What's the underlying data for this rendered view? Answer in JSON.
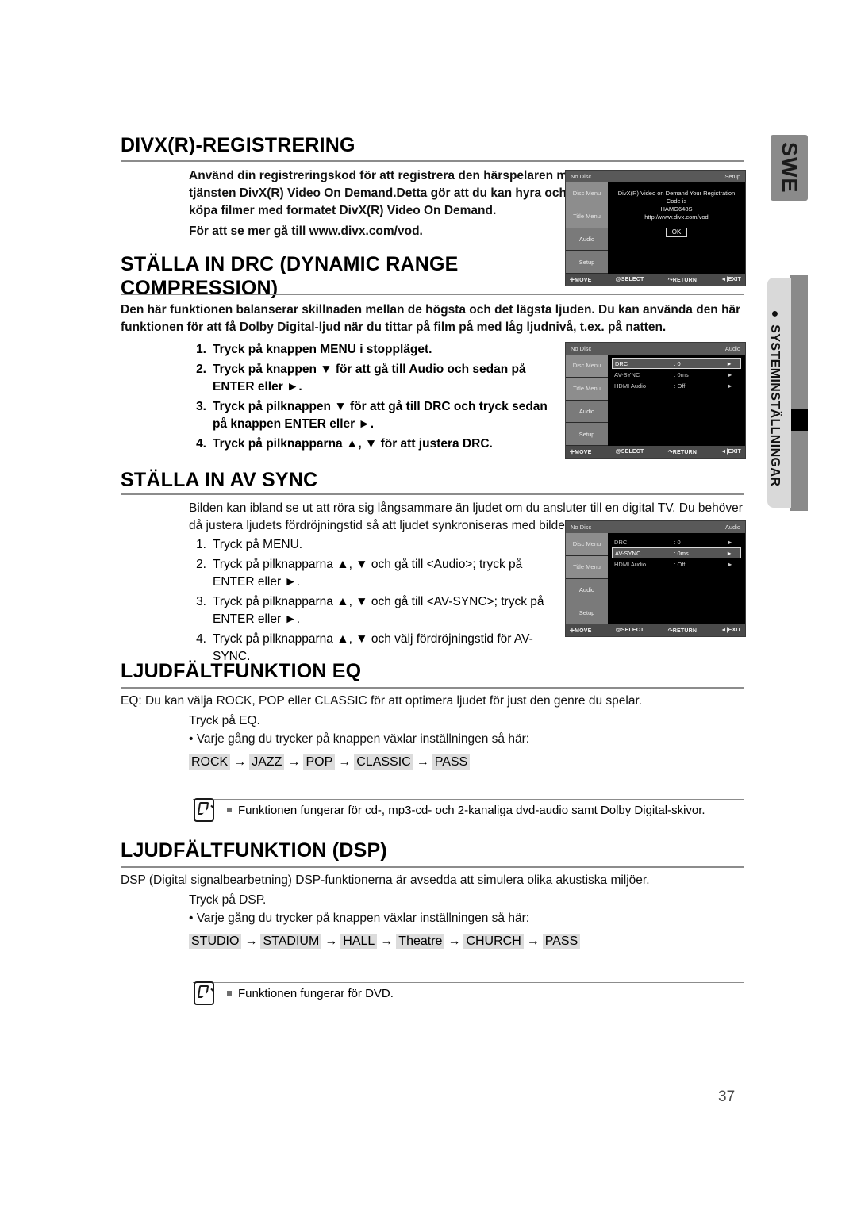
{
  "page": {
    "number": "37",
    "language_tab": "SWE",
    "side_label": "SYSTEMINSTÄLLNINGAR",
    "side_bullet": "●"
  },
  "sections": {
    "divx": {
      "heading": "DIVX(R)-REGISTRERING",
      "body": "Använd din registreringskod för att registrera den härspelaren med tjänsten DivX(R) Video On Demand.Detta gör att du kan hyra och köpa filmer med formatet DivX(R) Video On Demand.",
      "body_line1": "Använd din registreringskod för att registrera den härspelaren med",
      "body_line2": "tjänsten DivX(R) Video On Demand.Detta gör att du kan hyra och",
      "body_line3": "köpa filmer med formatet DivX(R) Video On Demand.",
      "body_line4": "För att se mer gå till www.divx.com/vod."
    },
    "drc": {
      "heading_line1": "STÄLLA IN DRC (DYNAMIC RANGE",
      "heading_line2": "COMPRESSION)",
      "intro_line1": "Den här funktionen balanserar skillnaden mellan de högsta och det lägsta ljuden. Du kan använda den här",
      "intro_line2": "funktionen för att få Dolby Digital-ljud när du tittar på film på med låg ljudnivå, t.ex. på natten.",
      "steps": [
        {
          "num": "1.",
          "text": "Tryck på knappen MENU i stoppläget."
        },
        {
          "num": "2.",
          "text": "Tryck på knappen ▼ för att gå till Audio  och sedan på ENTER eller ►."
        },
        {
          "num": "3.",
          "text": "Tryck på pilknappen ▼ för att gå till DRC och tryck sedan på knappen ENTER eller ►."
        },
        {
          "num": "4.",
          "text": "Tryck på pilknapparna ▲, ▼ för att justera DRC."
        }
      ]
    },
    "avsync": {
      "heading": "STÄLLA IN AV SYNC",
      "intro_line1": "Bilden kan ibland se ut att röra sig långsammare än ljudet om du ansluter till en digital TV. Du behöver",
      "intro_line2": "då justera ljudets fördröjningstid så att ljudet synkroniseras med bilden.",
      "steps": [
        {
          "num": "1.",
          "text": "Tryck på MENU."
        },
        {
          "num": "2.",
          "text": "Tryck på pilknapparna ▲, ▼ och gå till <Audio>; tryck på ENTER eller ►."
        },
        {
          "num": "3.",
          "text": "Tryck på pilknapparna ▲, ▼ och gå till <AV-SYNC>; tryck på ENTER eller ►."
        },
        {
          "num": "4.",
          "text": "Tryck på pilknapparna ▲, ▼ och välj fördröjningstid för AV-SYNC."
        }
      ]
    },
    "eq": {
      "heading": "LJUDFÄLTFUNKTION EQ",
      "intro": "EQ: Du kan välja ROCK, POP eller CLASSIC för att optimera ljudet för just den genre du spelar.",
      "press": "Tryck på EQ.",
      "bullet": "• Varje gång du trycker på knappen växlar inställningen så här:",
      "chain": [
        "ROCK",
        "JAZZ",
        "POP",
        "CLASSIC",
        "PASS"
      ],
      "arrow": "→",
      "note": "Funktionen fungerar för cd-, mp3-cd- och 2-kanaliga dvd-audio samt Dolby Digital-skivor."
    },
    "dsp": {
      "heading": "LJUDFÄLTFUNKTION (DSP)",
      "intro": "DSP (Digital signalbearbetning) DSP-funktionerna är avsedda att simulera olika akustiska miljöer.",
      "press": "Tryck på DSP.",
      "bullet": "• Varje gång du trycker på knappen växlar inställningen så här:",
      "chain": [
        "STUDIO",
        "STADIUM",
        "HALL",
        "Theatre",
        "CHURCH",
        "PASS"
      ],
      "arrow": "→",
      "note": "Funktionen fungerar för DVD."
    }
  },
  "osd": {
    "common": {
      "disc_status": "No Disc",
      "menu_items": [
        "Disc Menu",
        "Title Menu",
        "Audio",
        "Setup"
      ],
      "footer": {
        "move": "MOVE",
        "select": "SELECT",
        "return": "RETURN",
        "exit": "EXIT",
        "move_icon": "✛",
        "select_icon": "@",
        "return_icon": "↷",
        "exit_icon": "◄|"
      }
    },
    "divx_screen": {
      "title": "Setup",
      "dialog_line1": "DivX(R) Video on Demand Your Registration",
      "dialog_line2": "Code is",
      "dialog_line3": "HAMG648S",
      "dialog_line4": "http://www.divx.com/vod",
      "ok_label": "OK"
    },
    "drc_screen": {
      "title": "Audio",
      "rows": [
        {
          "label": "DRC",
          "value": ": 0",
          "arrow": "►",
          "selected": true
        },
        {
          "label": "AV-SYNC",
          "value": ": 0ms",
          "arrow": "►",
          "selected": false
        },
        {
          "label": "HDMI Audio",
          "value": ": Off",
          "arrow": "►",
          "selected": false
        }
      ]
    },
    "avsync_screen": {
      "title": "Audio",
      "rows": [
        {
          "label": "DRC",
          "value": ": 0",
          "arrow": "►",
          "selected": false
        },
        {
          "label": "AV-SYNC",
          "value": ": 0ms",
          "arrow": "►",
          "selected": true
        },
        {
          "label": "HDMI Audio",
          "value": ": Off",
          "arrow": "►",
          "selected": false
        }
      ]
    }
  },
  "colors": {
    "rule": "#8c8c8c",
    "chip": "#dcdcdc",
    "tab": "#8a8a8a",
    "side_label_bg": "#d9d9d9"
  }
}
